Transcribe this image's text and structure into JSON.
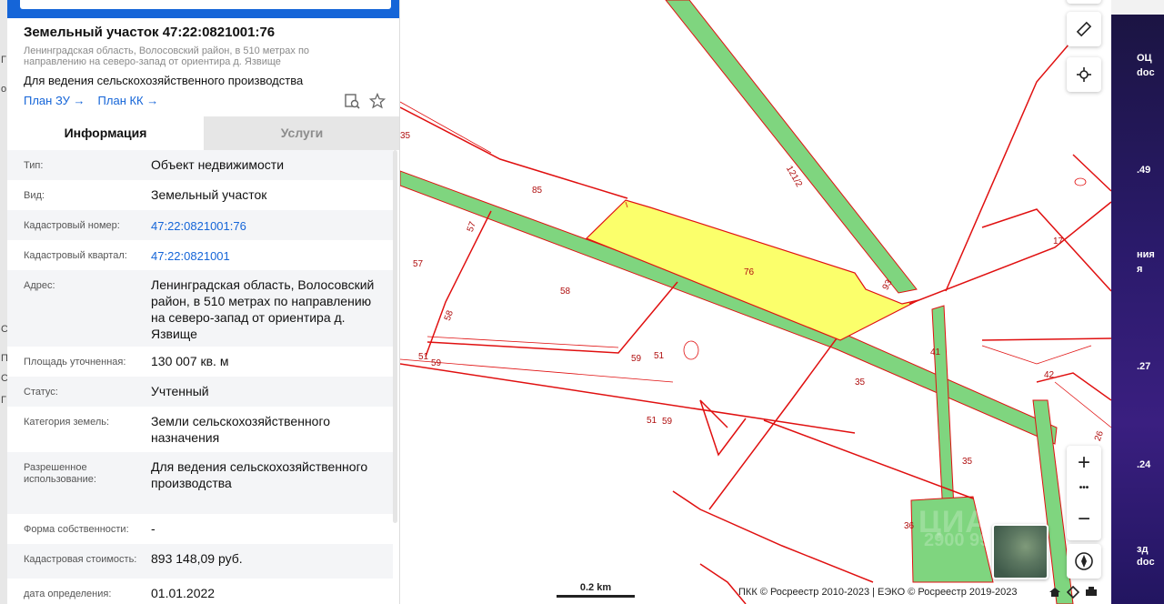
{
  "left_strip": [
    "Г",
    "о",
    "С",
    "П",
    "С",
    "Г"
  ],
  "right_strip": [
    "ОЦ",
    "doc",
    ".49",
    "ния",
    "я",
    ".27",
    ".24",
    "зд",
    "doc"
  ],
  "parcel": {
    "title": "Земельный участок 47:22:0821001:76",
    "subtitle": "Ленинградская область, Волосовский район, в 510 метрах по направлению на северо-запад от ориентира д. Язвище",
    "purpose": "Для ведения сельскохозяйственного производства",
    "links": [
      "План ЗУ →",
      "План КК →"
    ]
  },
  "tabs": [
    {
      "label": "Информация",
      "active": true
    },
    {
      "label": "Услуги",
      "active": false
    }
  ],
  "rows": [
    {
      "label": "Тип:",
      "value": "Объект недвижимости",
      "link": false
    },
    {
      "label": "Вид:",
      "value": "Земельный участок",
      "link": false
    },
    {
      "label": "Кадастровый номер:",
      "value": "47:22:0821001:76",
      "link": true
    },
    {
      "label": "Кадастровый квартал:",
      "value": "47:22:0821001",
      "link": true
    },
    {
      "label": "Адрес:",
      "value": "Ленинградская область, Волосовский район, в 510 метрах по направлению на северо-запад от ориентира д. Язвище",
      "link": false
    },
    {
      "label": "Площадь уточненная:",
      "value": "130 007 кв. м",
      "link": false
    },
    {
      "label": "Статус:",
      "value": "Учтенный",
      "link": false
    },
    {
      "label": "Категория земель:",
      "value": "Земли сельскохозяйственного назначения",
      "link": false
    },
    {
      "label": "Разрешенное использование:",
      "value": "Для ведения сельскохозяйственного производства",
      "link": false
    },
    {
      "label": "Форма собственности:",
      "value": "-",
      "link": false
    },
    {
      "label": "Кадастровая стоимость:",
      "value": "893 148,09 руб.",
      "link": false
    },
    {
      "label": "дата определения:",
      "value": "01.01.2022",
      "link": false
    }
  ],
  "map": {
    "parcel_labels": [
      "85",
      "57",
      "57",
      "58",
      "58",
      "51",
      "59",
      "59",
      "51",
      "51",
      "59",
      "76",
      "93",
      "41",
      "35",
      "35",
      "42",
      "36",
      "17",
      "26",
      "121/2",
      "35"
    ],
    "highlight_color": "#fbff6b",
    "line_color": "#e01010",
    "road_color": "#7fd57f"
  },
  "controls": {
    "ruler_icon": "ruler-icon",
    "locate_icon": "crosshair-icon",
    "zoom_in": "+",
    "more": "•••",
    "zoom_out": "−",
    "compass_icon": "compass-icon"
  },
  "scale_label": "0.2 km",
  "watermark": {
    "line1": "ЦИАН",
    "line2": "2900 9999"
  },
  "attribution": "ПКК © Росреестр 2010-2023 | ЕЭКО © Росреестр 2019-2023"
}
